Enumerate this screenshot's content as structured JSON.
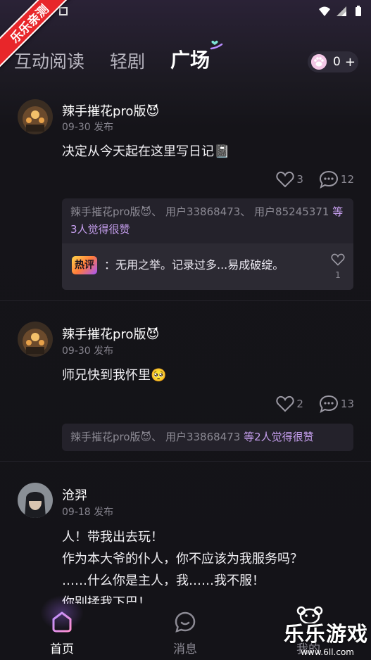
{
  "ribbon": {
    "text": "乐乐亲测"
  },
  "top_tabs": [
    {
      "label": "互动阅读"
    },
    {
      "label": "轻剧"
    },
    {
      "label": "广场"
    }
  ],
  "coins": {
    "count": "0",
    "plus": "+"
  },
  "posts": [
    {
      "username": "辣手摧花pro版😈",
      "time": "09-30 发布",
      "content": "决定从今天起在这里写日记📓",
      "likes": "3",
      "comments": "12",
      "liked_by": "辣手摧花pro版😈、 用户33868473、 用户85245371",
      "liked_by_tail": "等3人觉得很赞",
      "hot_badge": "热评",
      "hot_comment": "：无用之举。记录过多...易成破绽。",
      "hot_comment_likes": "1"
    },
    {
      "username": "辣手摧花pro版😈",
      "time": "09-30 发布",
      "content": "师兄快到我怀里🥺",
      "likes": "2",
      "comments": "13",
      "liked_by": "辣手摧花pro版😈、 用户33868473",
      "liked_by_tail": "等2人觉得很赞"
    },
    {
      "username": "沧羿",
      "time": "09-18 发布",
      "content": "人！带我出去玩！\n作为本大爷的仆人，你不应该为我服务吗？\n……什么你是主人，我……我不服！\n你别揉我下巴！"
    }
  ],
  "bottom_nav": [
    {
      "label": "首页"
    },
    {
      "label": "消息"
    },
    {
      "label": "我的"
    }
  ],
  "watermark": {
    "title": "乐乐游戏",
    "url": "www.6ll.com"
  },
  "colors": {
    "accent": "#c7a0f0",
    "ribbon": "#e8262a",
    "background": "#141318"
  }
}
